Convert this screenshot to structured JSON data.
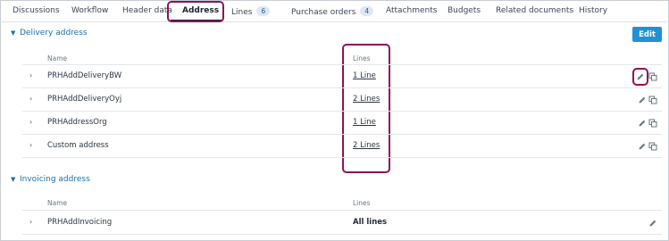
{
  "tabs": [
    {
      "label": "Discussions"
    },
    {
      "label": "Workflow"
    },
    {
      "label": "Header data"
    },
    {
      "label": "Address",
      "active": true
    },
    {
      "label": "Lines",
      "badge": "6"
    },
    {
      "label": "Purchase orders",
      "badge": "4"
    },
    {
      "label": "Attachments"
    },
    {
      "label": "Budgets"
    },
    {
      "label": "Related documents"
    },
    {
      "label": "History"
    }
  ],
  "delivery": {
    "title": "Delivery address",
    "edit_label": "Edit",
    "columns": {
      "name": "Name",
      "lines": "Lines"
    },
    "rows": [
      {
        "name": "PRHAddDeliveryBW",
        "lines": "1 Line"
      },
      {
        "name": "PRHAddDeliveryOyj",
        "lines": "2 Lines"
      },
      {
        "name": "PRHAddressOrg",
        "lines": "1 Line"
      },
      {
        "name": "Custom address",
        "lines": "2 Lines"
      }
    ]
  },
  "invoicing": {
    "title": "Invoicing address",
    "columns": {
      "name": "Name",
      "lines": "Lines"
    },
    "rows": [
      {
        "name": "PRHAddInvoicing",
        "lines": "All lines"
      }
    ]
  },
  "icons": {
    "expand": "chevron-right-icon",
    "section": "chevron-down-icon",
    "edit": "pencil-icon",
    "copy": "copy-icon"
  },
  "colors": {
    "accent": "#2191d4",
    "highlight": "#8b1458",
    "section_title": "#1d6fa5"
  }
}
